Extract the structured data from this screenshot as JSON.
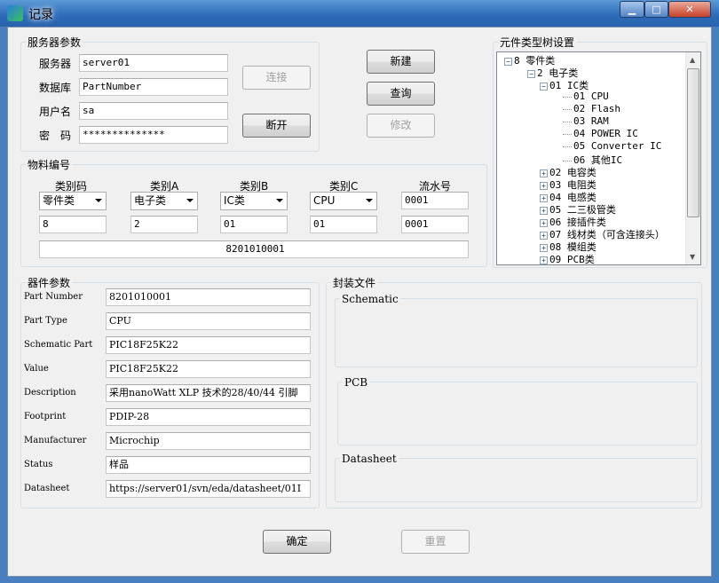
{
  "window": {
    "title": "记录",
    "minimize": "▁",
    "maximize": "□",
    "close": "✕"
  },
  "server": {
    "group_title": "服务器参数",
    "server_label": "服务器",
    "server_value": "server01",
    "db_label": "数据库",
    "db_value": "PartNumber",
    "user_label": "用户名",
    "user_value": "sa",
    "pwd_label": "密　码",
    "pwd_value": "**************",
    "connect": "连接",
    "disconnect": "断开"
  },
  "actions": {
    "new": "新建",
    "query": "查询",
    "modify": "修改"
  },
  "tree": {
    "group_title": "元件类型树设置",
    "nodes": [
      {
        "text": "8 零件类",
        "toggle": "−"
      },
      {
        "text": "2 电子类",
        "toggle": "−"
      },
      {
        "text": "01 IC类",
        "toggle": "−"
      },
      {
        "text": "01 CPU"
      },
      {
        "text": "02 Flash"
      },
      {
        "text": "03 RAM"
      },
      {
        "text": "04 POWER IC"
      },
      {
        "text": "05 Converter IC"
      },
      {
        "text": "06 其他IC"
      },
      {
        "text": "02 电容类",
        "toggle": "+"
      },
      {
        "text": "03 电阻类",
        "toggle": "+"
      },
      {
        "text": "04 电感类",
        "toggle": "+"
      },
      {
        "text": "05 二三极管类",
        "toggle": "+"
      },
      {
        "text": "06 接插件类",
        "toggle": "+"
      },
      {
        "text": "07 线材类（可含连接头）",
        "toggle": "+"
      },
      {
        "text": "08 模组类",
        "toggle": "+"
      },
      {
        "text": "09 PCB类",
        "toggle": "+"
      }
    ]
  },
  "material": {
    "group_title": "物料编号",
    "headers": [
      "类别码",
      "类别A",
      "类别B",
      "类别C",
      "流水号"
    ],
    "selects": [
      "零件类",
      "电子类",
      "IC类",
      "CPU"
    ],
    "serial": "0001",
    "codes": [
      "8",
      "2",
      "01",
      "01",
      "0001"
    ],
    "full_code": "8201010001"
  },
  "params": {
    "group_title": "器件参数",
    "rows": [
      {
        "label": "Part Number",
        "value": "8201010001"
      },
      {
        "label": "Part Type",
        "value": "CPU"
      },
      {
        "label": "Schematic Part",
        "value": "PIC18F25K22"
      },
      {
        "label": "Value",
        "value": "PIC18F25K22"
      },
      {
        "label": "Description",
        "value": "采用nanoWatt XLP 技术的28/40/44 引脚"
      },
      {
        "label": "Footprint",
        "value": "PDIP-28"
      },
      {
        "label": "Manufacturer",
        "value": "Microchip"
      },
      {
        "label": "Status",
        "value": "样品"
      },
      {
        "label": "Datasheet",
        "value": "https://server01/svn/eda/datasheet/01I"
      }
    ]
  },
  "package": {
    "group_title": "封装文件",
    "schematic": "Schematic",
    "pcb": "PCB",
    "datasheet": "Datasheet"
  },
  "footer": {
    "ok": "确定",
    "reset": "重置"
  }
}
